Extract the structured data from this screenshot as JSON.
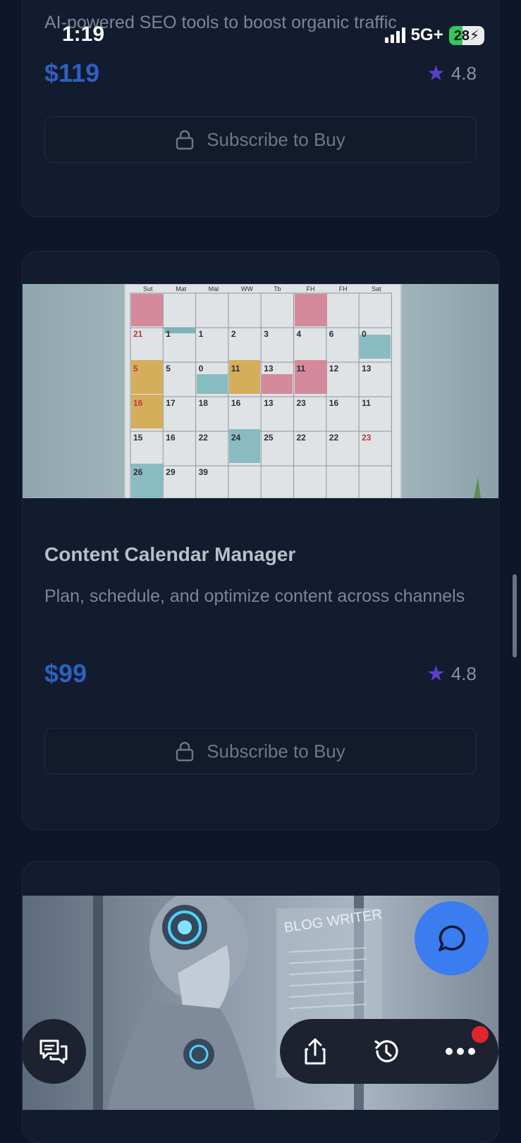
{
  "status_bar": {
    "time": "1:19",
    "network": "5G+",
    "battery": "28"
  },
  "cards": [
    {
      "description": "AI-powered SEO tools to boost organic traffic",
      "price": "$119",
      "rating": "4.8",
      "button_label": "Subscribe to Buy"
    },
    {
      "title": "Content Calendar Manager",
      "description": "Plan, schedule, and optimize content across channels",
      "price": "$99",
      "rating": "4.8",
      "button_label": "Subscribe to Buy",
      "image": {
        "weekday_headers": [
          "Sut",
          "Mat",
          "Mal",
          "WW",
          "Tb",
          "FH",
          "FH",
          "Sat"
        ],
        "cells": [
          "21",
          "1",
          "1",
          "2",
          "3",
          "4",
          "6",
          "0",
          "5",
          "5",
          "0",
          "11",
          "13",
          "11",
          "12",
          "13",
          "16",
          "17",
          "18",
          "16",
          "13",
          "23",
          "16",
          "11",
          "15",
          "16",
          "22",
          "24",
          "25",
          "22",
          "22",
          "23",
          "26",
          "29",
          "39"
        ]
      }
    },
    {
      "image_text": "BLOG WRITER"
    }
  ],
  "icons": {
    "lock": "lock-icon",
    "star": "star-icon",
    "chat_fab": "chat-bubble-icon",
    "messages": "messages-icon",
    "share": "share-icon",
    "history": "history-icon",
    "more": "more-icon"
  }
}
